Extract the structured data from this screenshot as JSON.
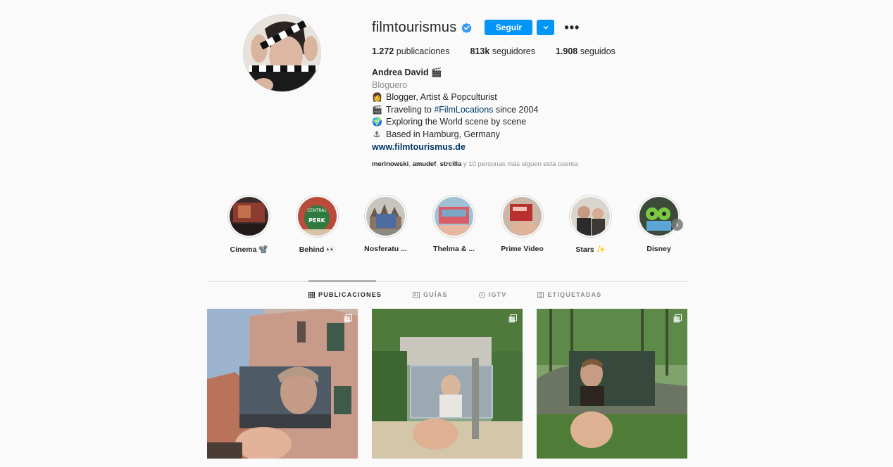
{
  "profile": {
    "username": "filmtourismus",
    "follow_label": "Seguir",
    "more_label": "•••",
    "stats": {
      "posts_count": "1.272",
      "posts_label": "publicaciones",
      "followers_count": "813k",
      "followers_label": "seguidores",
      "following_count": "1.908",
      "following_label": "seguidos"
    },
    "bio": {
      "name": "Andrea David 🎬",
      "category": "Bloguero",
      "lines": [
        {
          "emoji": "👩",
          "text": "Blogger, Artist & Popculturist"
        },
        {
          "emoji": "🎬",
          "text_before": "Traveling to ",
          "hashtag": "#FilmLocations",
          "text_after": " since 2004"
        },
        {
          "emoji": "🌍",
          "text": "Exploring the World scene by scene"
        },
        {
          "emoji": "⚓",
          "text": "Based in Hamburg, Germany"
        }
      ],
      "website": "www.filmtourismus.de"
    },
    "followed_by": {
      "users": [
        "merinowski",
        "amudef",
        "strcilla"
      ],
      "suffix": "y 10 personas más siguen esta cuenta"
    }
  },
  "highlights": [
    {
      "label": "Cinema 📽️"
    },
    {
      "label": "Behind 👀"
    },
    {
      "label": "Nosferatu ..."
    },
    {
      "label": "Thelma & ..."
    },
    {
      "label": "Prime Video"
    },
    {
      "label": "Stars ✨"
    },
    {
      "label": "Disney"
    }
  ],
  "tabs": [
    {
      "label": "PUBLICACIONES",
      "icon": "grid-icon",
      "active": true
    },
    {
      "label": "GUÍAS",
      "icon": "guide-icon",
      "active": false
    },
    {
      "label": "IGTV",
      "icon": "igtv-icon",
      "active": false
    },
    {
      "label": "ETIQUETADAS",
      "icon": "tagged-icon",
      "active": false
    }
  ],
  "colors": {
    "accent": "#0095f6",
    "link": "#00376b",
    "muted": "#8e8e8e",
    "background": "#fafafa"
  }
}
